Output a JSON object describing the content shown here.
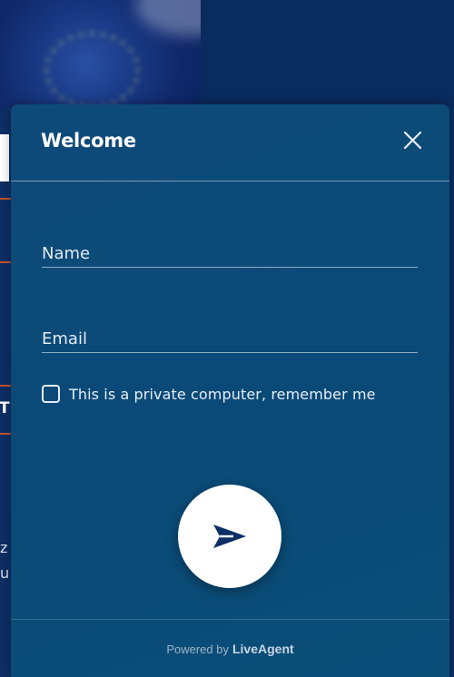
{
  "background": {
    "fragments": [
      "T",
      "z",
      "u"
    ]
  },
  "widget": {
    "title": "Welcome",
    "name_placeholder": "Name",
    "email_placeholder": "Email",
    "remember_label": "This is a private computer, remember me",
    "footer": {
      "prefix": "Powered by",
      "brand": "LiveAgent"
    }
  },
  "colors": {
    "panel": "#0b4a78",
    "page_background": "#0d2f66",
    "accent_line": "#c9502a",
    "send_icon": "#0d2e66"
  },
  "icons": {
    "close": "close-icon",
    "send": "send-icon",
    "checkbox": "checkbox-icon"
  }
}
